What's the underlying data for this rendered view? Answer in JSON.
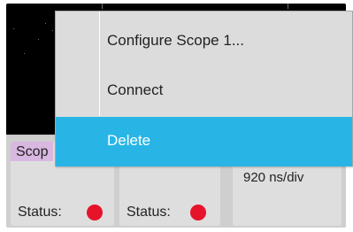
{
  "context_menu": {
    "items": [
      {
        "label": "Configure Scope 1..."
      },
      {
        "label": "Connect"
      },
      {
        "label": "Delete",
        "highlighted": true
      }
    ]
  },
  "badges": [
    {
      "tab": "Scop",
      "status_label": "Status:",
      "status_color": "#e6142a"
    },
    {
      "status_label": "Status:",
      "status_color": "#e6142a"
    },
    {
      "timebase": "920 ns/div"
    }
  ],
  "colors": {
    "menu_highlight": "#28b5e6",
    "badge_tab": "#d8b7e0",
    "display_bg": "#000000"
  }
}
